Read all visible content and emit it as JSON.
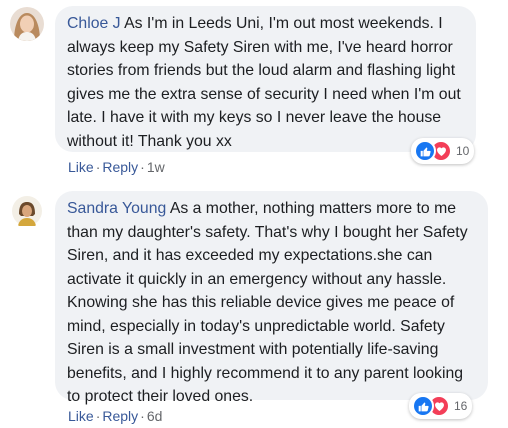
{
  "comments": [
    {
      "author": "Chloe J",
      "text": "As I'm in Leeds Uni, I'm out most weekends. I always keep my Safety Siren with me, I've heard horror stories from friends but the loud alarm and flashing light gives me the extra sense of security I need when I'm out late. I have it with my keys so I never leave the house without it! Thank you xx",
      "reactions_count": "10",
      "like_label": "Like",
      "reply_label": "Reply",
      "time": "1w"
    },
    {
      "author": "Sandra Young",
      "text": "As a mother, nothing matters more to me than my daughter's safety. That's why I bought her Safety Siren, and it has exceeded my expectations.she can activate it quickly in an emergency without any hassle. Knowing she has this reliable device gives me peace of mind, especially in today's unpredictable world. Safety Siren is a small investment with potentially life-saving benefits, and I highly recommend it to any parent looking to protect their loved ones.",
      "reactions_count": "16",
      "like_label": "Like",
      "reply_label": "Reply",
      "time": "6d"
    }
  ],
  "colors": {
    "link": "#385898",
    "bubble": "#f0f2f5",
    "meta": "#65676b",
    "like_reaction": "#1877f2",
    "love_reaction": "#f33e58"
  },
  "icons": [
    "avatar",
    "like-reaction-icon",
    "love-reaction-icon"
  ]
}
